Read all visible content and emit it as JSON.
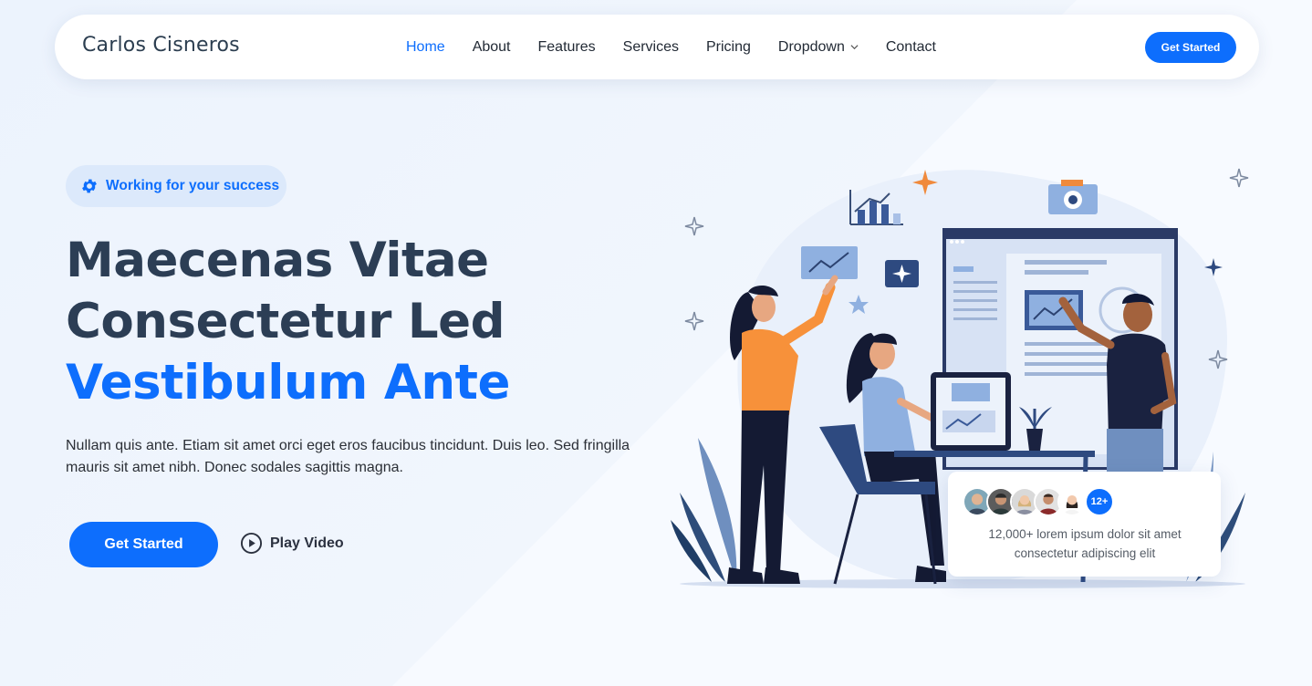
{
  "header": {
    "logo": "Carlos Cisneros",
    "nav": [
      {
        "label": "Home",
        "active": true
      },
      {
        "label": "About"
      },
      {
        "label": "Features"
      },
      {
        "label": "Services"
      },
      {
        "label": "Pricing"
      },
      {
        "label": "Dropdown",
        "has_dropdown": true
      },
      {
        "label": "Contact"
      }
    ],
    "cta_label": "Get Started"
  },
  "hero": {
    "badge_icon": "gear-icon",
    "badge_text": "Working for your success",
    "title_line1": "Maecenas Vitae",
    "title_line2": "Consectetur Led",
    "title_line3": "Vestibulum Ante",
    "description": "Nullam quis ante. Etiam sit amet orci eget eros faucibus tincidunt. Duis leo. Sed fringilla mauris sit amet nibh. Donec sodales sagittis magna.",
    "primary_button": "Get Started",
    "play_label": "Play Video",
    "play_icon": "play-circle-icon"
  },
  "customers": {
    "count_badge": "12+",
    "text": "12,000+ lorem ipsum dolor sit amet consectetur adipiscing elit"
  },
  "colors": {
    "accent": "#0d6efd",
    "heading": "#2c3e55",
    "badge_bg": "#dce9fb"
  }
}
